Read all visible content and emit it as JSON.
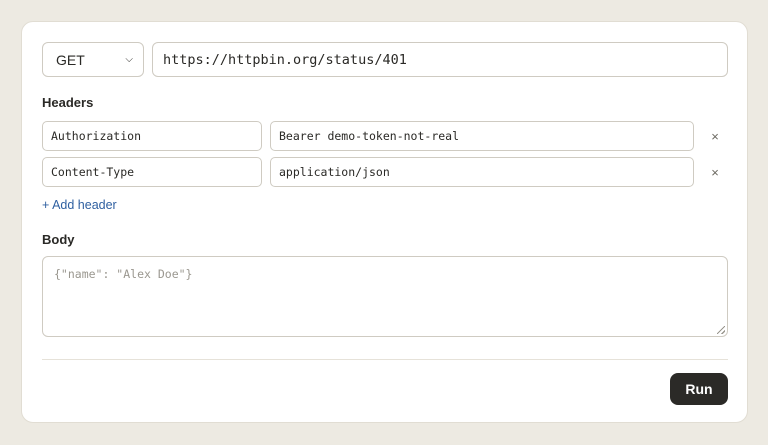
{
  "request": {
    "method": "GET",
    "url": "https://httpbin.org/status/401"
  },
  "headers": {
    "label": "Headers",
    "rows": [
      {
        "key": "Authorization",
        "value": "Bearer demo-token-not-real",
        "remove": "×"
      },
      {
        "key": "Content-Type",
        "value": "application/json",
        "remove": "×"
      }
    ],
    "add_label": "+ Add header"
  },
  "body": {
    "label": "Body",
    "placeholder": "{\"name\": \"Alex Doe\"}"
  },
  "actions": {
    "run_label": "Run"
  },
  "colors": {
    "accent_link": "#2e5fa0",
    "run_button": "#2b2a27",
    "page_background": "#edeae2"
  }
}
